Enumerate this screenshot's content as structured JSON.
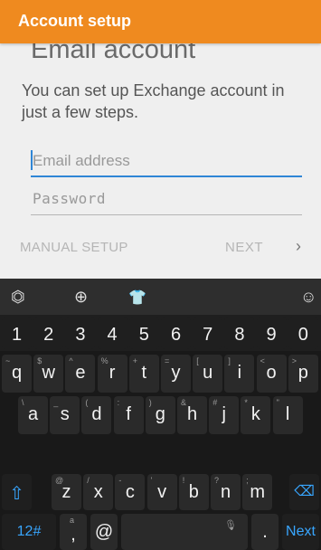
{
  "appbar": {
    "title": "Account setup"
  },
  "content": {
    "heading": "Email account",
    "description": "You can set up Exchange account in just a few steps.",
    "email": {
      "value": "",
      "placeholder": "Email address"
    },
    "password": {
      "value": "",
      "placeholder": "Password"
    },
    "manual_setup_label": "MANUAL SETUP",
    "next_label": "NEXT",
    "next_chevron": "›"
  },
  "keyboard": {
    "toolbar": {
      "swype": "⏣",
      "globe": "⊕",
      "theme": "👕",
      "emoji": "☺"
    },
    "number_row": [
      "1",
      "2",
      "3",
      "4",
      "5",
      "6",
      "7",
      "8",
      "9",
      "0"
    ],
    "row1": [
      {
        "main": "q",
        "sub": "~"
      },
      {
        "main": "w",
        "sub": "$"
      },
      {
        "main": "e",
        "sub": "^"
      },
      {
        "main": "r",
        "sub": "%"
      },
      {
        "main": "t",
        "sub": "+"
      },
      {
        "main": "y",
        "sub": "="
      },
      {
        "main": "u",
        "sub": "["
      },
      {
        "main": "i",
        "sub": "]"
      },
      {
        "main": "o",
        "sub": "<"
      },
      {
        "main": "p",
        "sub": ">"
      }
    ],
    "row2": [
      {
        "main": "a",
        "sub": "\\"
      },
      {
        "main": "s",
        "sub": "_"
      },
      {
        "main": "d",
        "sub": "("
      },
      {
        "main": "f",
        "sub": ":"
      },
      {
        "main": "g",
        "sub": ")"
      },
      {
        "main": "h",
        "sub": "&"
      },
      {
        "main": "j",
        "sub": "#"
      },
      {
        "main": "k",
        "sub": "*"
      },
      {
        "main": "l",
        "sub": "\""
      }
    ],
    "row3": [
      {
        "main": "z",
        "sub": "@"
      },
      {
        "main": "x",
        "sub": "/"
      },
      {
        "main": "c",
        "sub": "-"
      },
      {
        "main": "v",
        "sub": "'"
      },
      {
        "main": "b",
        "sub": "!"
      },
      {
        "main": "n",
        "sub": "?"
      },
      {
        "main": "m",
        "sub": ";"
      }
    ],
    "shift_icon": "⇧",
    "backspace_icon": "⌫",
    "symbols_label": "12#",
    "comma_label": ",",
    "comma_sub": "a",
    "at_label": "@",
    "mic_icon": "🎙",
    "period_label": ".",
    "next_key_label": "Next",
    "colors": {
      "accent": "#ef8a1f",
      "focus": "#2f86d6",
      "kb_blue": "#38a6ff"
    }
  }
}
